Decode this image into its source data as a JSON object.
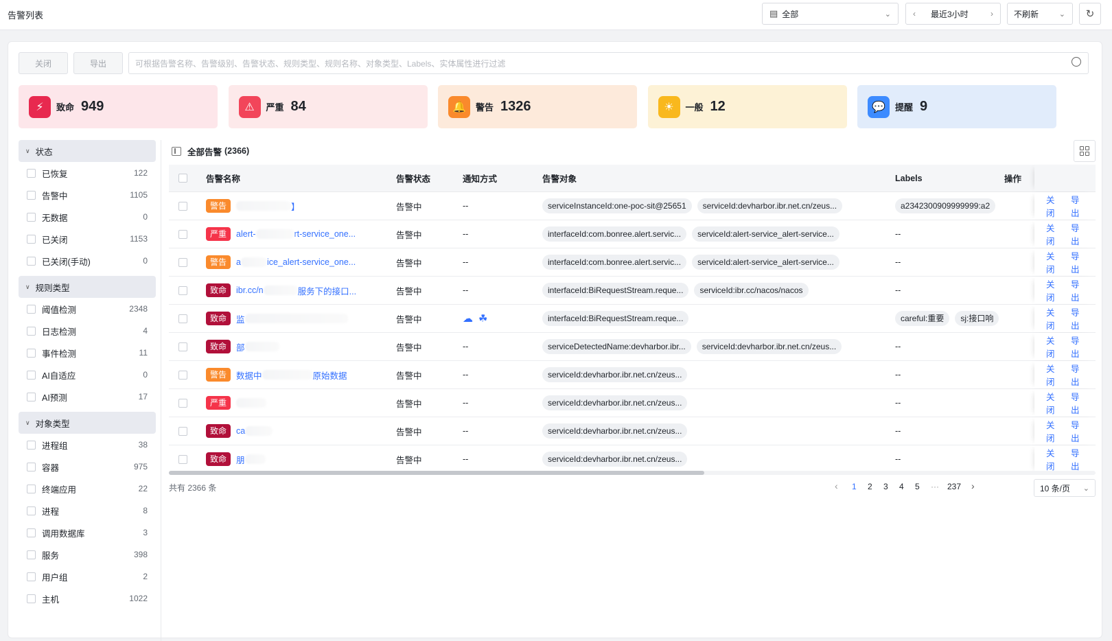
{
  "header": {
    "title": "告警列表",
    "scope_value": "全部",
    "time_range": "最近3小时",
    "refresh_value": "不刷新"
  },
  "toolbar": {
    "close_label": "关闭",
    "export_label": "导出",
    "search_placeholder": "可根据告警名称、告警级别、告警状态、规则类型、规则名称、对象类型、Labels、实体属性进行过滤"
  },
  "severity": [
    {
      "label": "致命",
      "count": "949",
      "color": "#e8294f",
      "bg": "#fde6ea"
    },
    {
      "label": "严重",
      "count": "84",
      "color": "#f2455a",
      "bg": "#fde9ea"
    },
    {
      "label": "警告",
      "count": "1326",
      "color": "#fa8a2c",
      "bg": "#fdeadb"
    },
    {
      "label": "一般",
      "count": "12",
      "color": "#f9b81d",
      "bg": "#fdf2d6"
    },
    {
      "label": "提醒",
      "count": "9",
      "color": "#3d8bff",
      "bg": "#e1ecfb"
    }
  ],
  "filters": [
    {
      "title": "状态",
      "items": [
        {
          "label": "已恢复",
          "count": "122"
        },
        {
          "label": "告警中",
          "count": "1105"
        },
        {
          "label": "无数据",
          "count": "0"
        },
        {
          "label": "已关闭",
          "count": "1153"
        },
        {
          "label": "已关闭(手动)",
          "count": "0"
        }
      ]
    },
    {
      "title": "规则类型",
      "items": [
        {
          "label": "阈值检测",
          "count": "2348"
        },
        {
          "label": "日志检测",
          "count": "4"
        },
        {
          "label": "事件检测",
          "count": "11"
        },
        {
          "label": "AI自适应",
          "count": "0"
        },
        {
          "label": "AI预测",
          "count": "17"
        }
      ]
    },
    {
      "title": "对象类型",
      "items": [
        {
          "label": "进程组",
          "count": "38"
        },
        {
          "label": "容器",
          "count": "975"
        },
        {
          "label": "终端应用",
          "count": "22"
        },
        {
          "label": "进程",
          "count": "8"
        },
        {
          "label": "调用数据库",
          "count": "3"
        },
        {
          "label": "服务",
          "count": "398"
        },
        {
          "label": "用户组",
          "count": "2"
        },
        {
          "label": "主机",
          "count": "1022"
        }
      ]
    }
  ],
  "list": {
    "title": "全部告警",
    "count": "(2366)",
    "columns": [
      "告警名称",
      "告警状态",
      "通知方式",
      "告警对象",
      "Labels",
      "操作"
    ],
    "op_close": "关闭",
    "op_export": "导出",
    "rows": [
      {
        "level": "警告",
        "cls": "t-warn",
        "name": "",
        "name_tail": "】",
        "status": "告警中",
        "notify": "--",
        "objects": [
          "serviceInstanceId:one-poc-sit@25651",
          "serviceId:devharbor.ibr.net.cn/zeus..."
        ],
        "labels": [
          "a2342300909999999:a2"
        ]
      },
      {
        "level": "严重",
        "cls": "t-sev",
        "name": "alert-",
        "name_tail": "rt-service_one...",
        "status": "告警中",
        "notify": "--",
        "objects": [
          "interfaceId:com.bonree.alert.servic...",
          "serviceId:alert-service_alert-service..."
        ],
        "labels": []
      },
      {
        "level": "警告",
        "cls": "t-warn",
        "name": "a",
        "name_tail": "ice_alert-service_one...",
        "status": "告警中",
        "notify": "--",
        "objects": [
          "interfaceId:com.bonree.alert.servic...",
          "serviceId:alert-service_alert-service..."
        ],
        "labels": []
      },
      {
        "level": "致命",
        "cls": "t-crit",
        "name": "ibr.cc/n",
        "name_tail": "服务下的接口...",
        "status": "告警中",
        "notify": "--",
        "objects": [
          "interfaceId:BiRequestStream.reque...",
          "serviceId:ibr.cc/nacos/nacos"
        ],
        "labels": []
      },
      {
        "level": "致命",
        "cls": "t-crit",
        "name": "监",
        "name_tail": "",
        "status": "告警中",
        "notify": "",
        "objects": [
          "interfaceId:BiRequestStream.reque..."
        ],
        "labels": [
          "careful:重要",
          "sj:接口响"
        ]
      },
      {
        "level": "致命",
        "cls": "t-crit",
        "name": "部",
        "name_tail": "",
        "status": "告警中",
        "notify": "--",
        "objects": [
          "serviceDetectedName:devharbor.ibr...",
          "serviceId:devharbor.ibr.net.cn/zeus..."
        ],
        "labels": []
      },
      {
        "level": "警告",
        "cls": "t-warn",
        "name": "数据中",
        "name_tail": "原始数据",
        "status": "告警中",
        "notify": "--",
        "objects": [
          "serviceId:devharbor.ibr.net.cn/zeus..."
        ],
        "labels": []
      },
      {
        "level": "严重",
        "cls": "t-sev",
        "name": "",
        "name_tail": "",
        "status": "告警中",
        "notify": "--",
        "objects": [
          "serviceId:devharbor.ibr.net.cn/zeus..."
        ],
        "labels": []
      },
      {
        "level": "致命",
        "cls": "t-crit",
        "name": "ca",
        "name_tail": "",
        "status": "告警中",
        "notify": "--",
        "objects": [
          "serviceId:devharbor.ibr.net.cn/zeus..."
        ],
        "labels": []
      },
      {
        "level": "致命",
        "cls": "t-crit",
        "name": "朋",
        "name_tail": "",
        "status": "告警中",
        "notify": "--",
        "objects": [
          "serviceId:devharbor.ibr.net.cn/zeus..."
        ],
        "labels": []
      }
    ],
    "empty_label": "--"
  },
  "pagination": {
    "total_text": "共有 2366 条",
    "pages": [
      "1",
      "2",
      "3",
      "4",
      "5"
    ],
    "ellipsis": "···",
    "last": "237",
    "page_size": "10 条/页"
  }
}
